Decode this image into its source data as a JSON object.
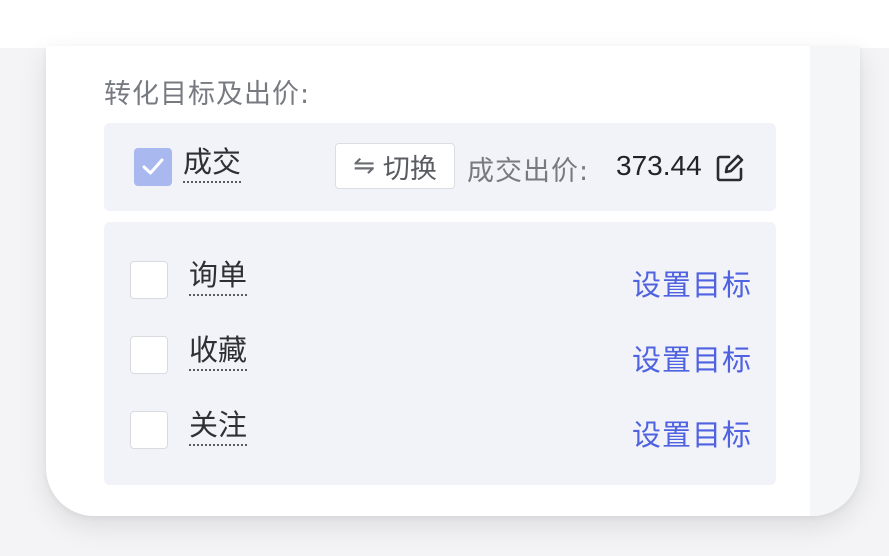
{
  "section_title": "转化目标及出价:",
  "primary_goal": {
    "label": "成交",
    "checked": true,
    "switch_button_label": "切换",
    "switch_icon": "swap-arrows-icon",
    "bid_label": "成交出价:",
    "bid_value": "373.44",
    "edit_icon": "edit-icon"
  },
  "secondary_goals": [
    {
      "label": "询单",
      "checked": false,
      "action_label": "设置目标"
    },
    {
      "label": "收藏",
      "checked": false,
      "action_label": "设置目标"
    },
    {
      "label": "关注",
      "checked": false,
      "action_label": "设置目标"
    }
  ],
  "colors": {
    "accent_link": "#4f62e0",
    "checkbox_checked": "#a9b8ef",
    "panel_bg": "#f2f3f9"
  }
}
